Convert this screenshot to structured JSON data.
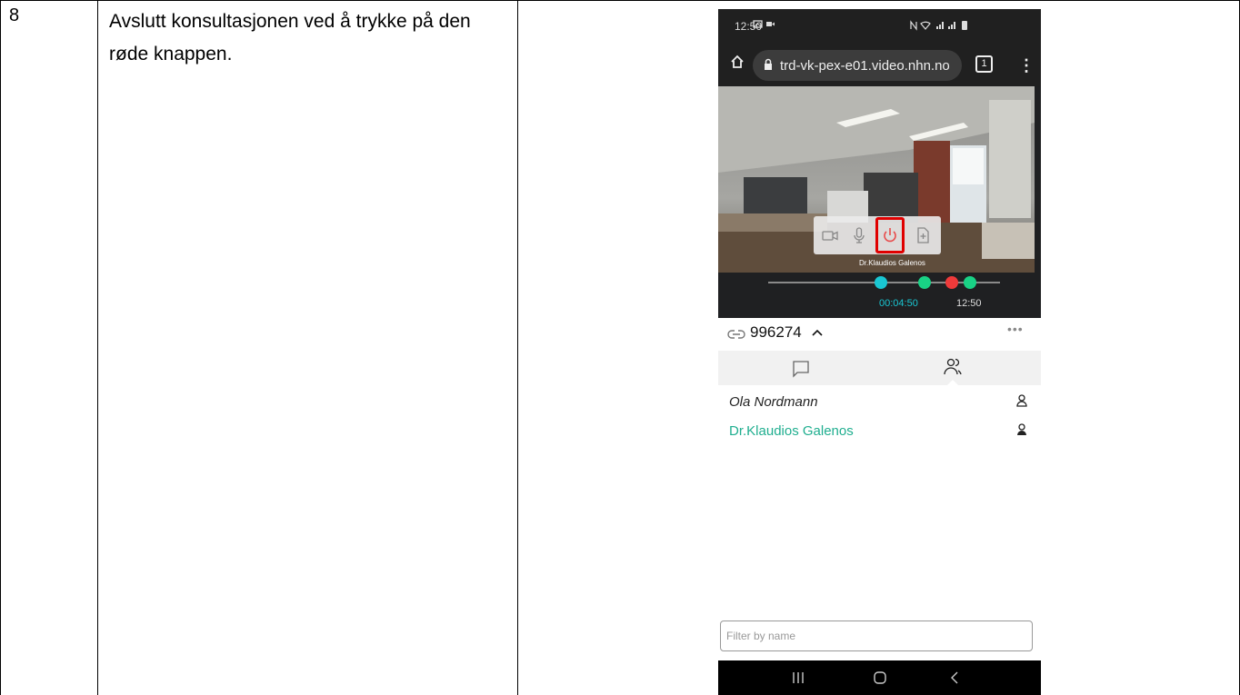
{
  "step": {
    "number": "8",
    "instruction": "Avslutt konsultasjonen ved å trykke på den røde knappen."
  },
  "status_bar": {
    "time": "12:50"
  },
  "browser": {
    "url": "trd-vk-pex-e01.video.nhn.no",
    "tab_count": "1"
  },
  "video": {
    "participant_label": "Dr.Klaudios Galenos",
    "timer_elapsed": "00:04:50",
    "timer_clock": "12:50"
  },
  "meeting": {
    "id": "996274"
  },
  "participants": [
    {
      "name": "Ola Nordmann",
      "color": "#222222"
    },
    {
      "name": "Dr.Klaudios Galenos",
      "color": "#1fae8f"
    }
  ],
  "filter": {
    "placeholder": "Filter by name"
  },
  "colors": {
    "highlight": "#e00000",
    "accent": "#1fae8f",
    "timeline_cyan": "#19c6d2",
    "timeline_green": "#19d285",
    "timeline_red": "#ee3a3a"
  },
  "icons": [
    "home-icon",
    "lock-icon",
    "tabs-icon",
    "menu-icon",
    "camera-icon",
    "microphone-icon",
    "hangup-icon",
    "share-icon",
    "link-icon",
    "chevron-up-icon",
    "more-icon",
    "chat-icon",
    "people-icon",
    "person-icon",
    "recents-icon",
    "home-nav-icon",
    "back-icon"
  ]
}
